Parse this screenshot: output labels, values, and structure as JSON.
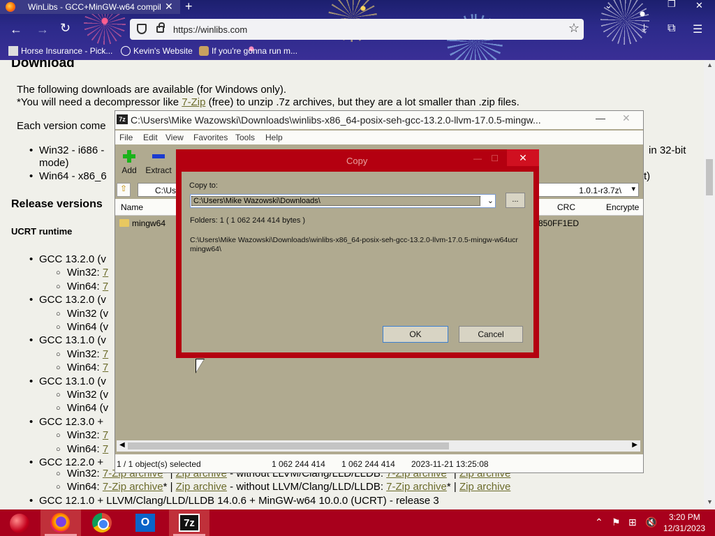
{
  "browser": {
    "tab_title": "WinLibs - GCC+MinGW-w64 compil",
    "tab_close": "✕",
    "new_tab": "+",
    "url": "https://winlibs.com",
    "bookmarks": [
      {
        "label": "Horse Insurance - Pick..."
      },
      {
        "label": "Kevin's Website"
      },
      {
        "label": "If you're gonna run m..."
      }
    ]
  },
  "page": {
    "download_heading": "Download",
    "intro_line1": "The following downloads are available (for Windows only).",
    "intro_line2_pre": "*You will need a decompressor like ",
    "intro_line2_link": "7-Zip",
    "intro_line2_post": " (free) to unzip .7z archives, but they are a lot smaller than .zip files.",
    "each_version": "Each version come",
    "win32_bullet": "Win32 - i686 -",
    "win32_tail": "in 32-bit",
    "win32_mode": "mode)",
    "win64_bullet": "Win64 - x86_6",
    "win64_tail": "t)",
    "release_versions": "Release versions",
    "ucrt_runtime": "UCRT runtime",
    "rows": [
      {
        "kind": "gcc",
        "text": "GCC 13.2.0 (v"
      },
      {
        "kind": "sub",
        "text": "Win32: ",
        "link": "7"
      },
      {
        "kind": "sub",
        "text": "Win64: ",
        "link": "7"
      },
      {
        "kind": "gcc",
        "text": "GCC 13.2.0 (v"
      },
      {
        "kind": "sub",
        "text": "Win32 (v",
        "link": ""
      },
      {
        "kind": "sub",
        "text": "Win64 (v",
        "link": ""
      },
      {
        "kind": "gcc",
        "text": "GCC 13.1.0 (v"
      },
      {
        "kind": "sub",
        "text": "Win32: ",
        "link": "7"
      },
      {
        "kind": "sub",
        "text": "Win64: ",
        "link": "7"
      },
      {
        "kind": "gcc",
        "text": "GCC 13.1.0 (v"
      },
      {
        "kind": "sub",
        "text": "Win32 (v",
        "link": ""
      },
      {
        "kind": "sub",
        "text": "Win64 (v",
        "link": ""
      },
      {
        "kind": "gcc",
        "text": "GCC 12.3.0 +"
      },
      {
        "kind": "sub",
        "text": "Win32: ",
        "link": "7"
      },
      {
        "kind": "sub",
        "text": "Win64: ",
        "link": "7"
      },
      {
        "kind": "gcc",
        "text": "GCC 12.2.0 +"
      }
    ],
    "win32_full": {
      "pre": "Win32: ",
      "a1": "7-Zip archive",
      "mid1": "* | ",
      "a2": "Zip archive",
      "mid2": "   -   without LLVM/Clang/LLD/LLDB: ",
      "a3": "7-Zip archive",
      "mid3": "* | ",
      "a4": "Zip archive"
    },
    "win64_full": {
      "pre": "Win64: ",
      "a1": "7-Zip archive",
      "mid1": "* | ",
      "a2": "Zip archive",
      "mid2": "   -   without LLVM/Clang/LLD/LLDB: ",
      "a3": "7-Zip archive",
      "mid3": "* | ",
      "a4": "Zip archive"
    },
    "last_gcc": "GCC 12.1.0 + LLVM/Clang/LLD/LLDB 14.0.6 + MinGW-w64 10.0.0 (UCRT) - release 3"
  },
  "zip_window": {
    "icon_text": "7z",
    "title": "C:\\Users\\Mike Wazowski\\Downloads\\winlibs-x86_64-posix-seh-gcc-13.2.0-llvm-17.0.5-mingw...",
    "menu": [
      "File",
      "Edit",
      "View",
      "Favorites",
      "Tools",
      "Help"
    ],
    "toolbar": {
      "add": "Add",
      "extract": "Extract"
    },
    "address_left": "C:\\Use",
    "address_right": "1.0.1-r3.7z\\",
    "columns": {
      "name": "Name",
      "crc": "CRC",
      "encrypted": "Encrypte"
    },
    "row": {
      "name": "mingw64",
      "crc": "850FF1ED"
    },
    "status": {
      "selected": "1 / 1 object(s) selected",
      "size": "1 062 244 414",
      "packed": "1 062 244 414",
      "modified": "2023-11-21 13:25:08"
    }
  },
  "copy_dialog": {
    "title": "Copy",
    "close": "✕",
    "copy_to_label": "Copy to:",
    "destination": "C:\\Users\\Mike Wazowski\\Downloads\\",
    "browse": "...",
    "folders_info": "Folders: 1    ( 1 062 244 414 bytes )",
    "source_path": "C:\\Users\\Mike Wazowski\\Downloads\\winlibs-x86_64-posix-seh-gcc-13.2.0-llvm-17.0.5-mingw-w64ucr\nmingw64\\",
    "ok": "OK",
    "cancel": "Cancel"
  },
  "taskbar": {
    "outlook_letter": "O",
    "zip_label": "7z",
    "time": "3:20 PM",
    "date": "12/31/2023"
  },
  "colors": {
    "taskbar": "#a8001c",
    "dialog_border": "#b40010",
    "dialog_bg": "#b0aa90",
    "link": "#6c6c2c"
  }
}
